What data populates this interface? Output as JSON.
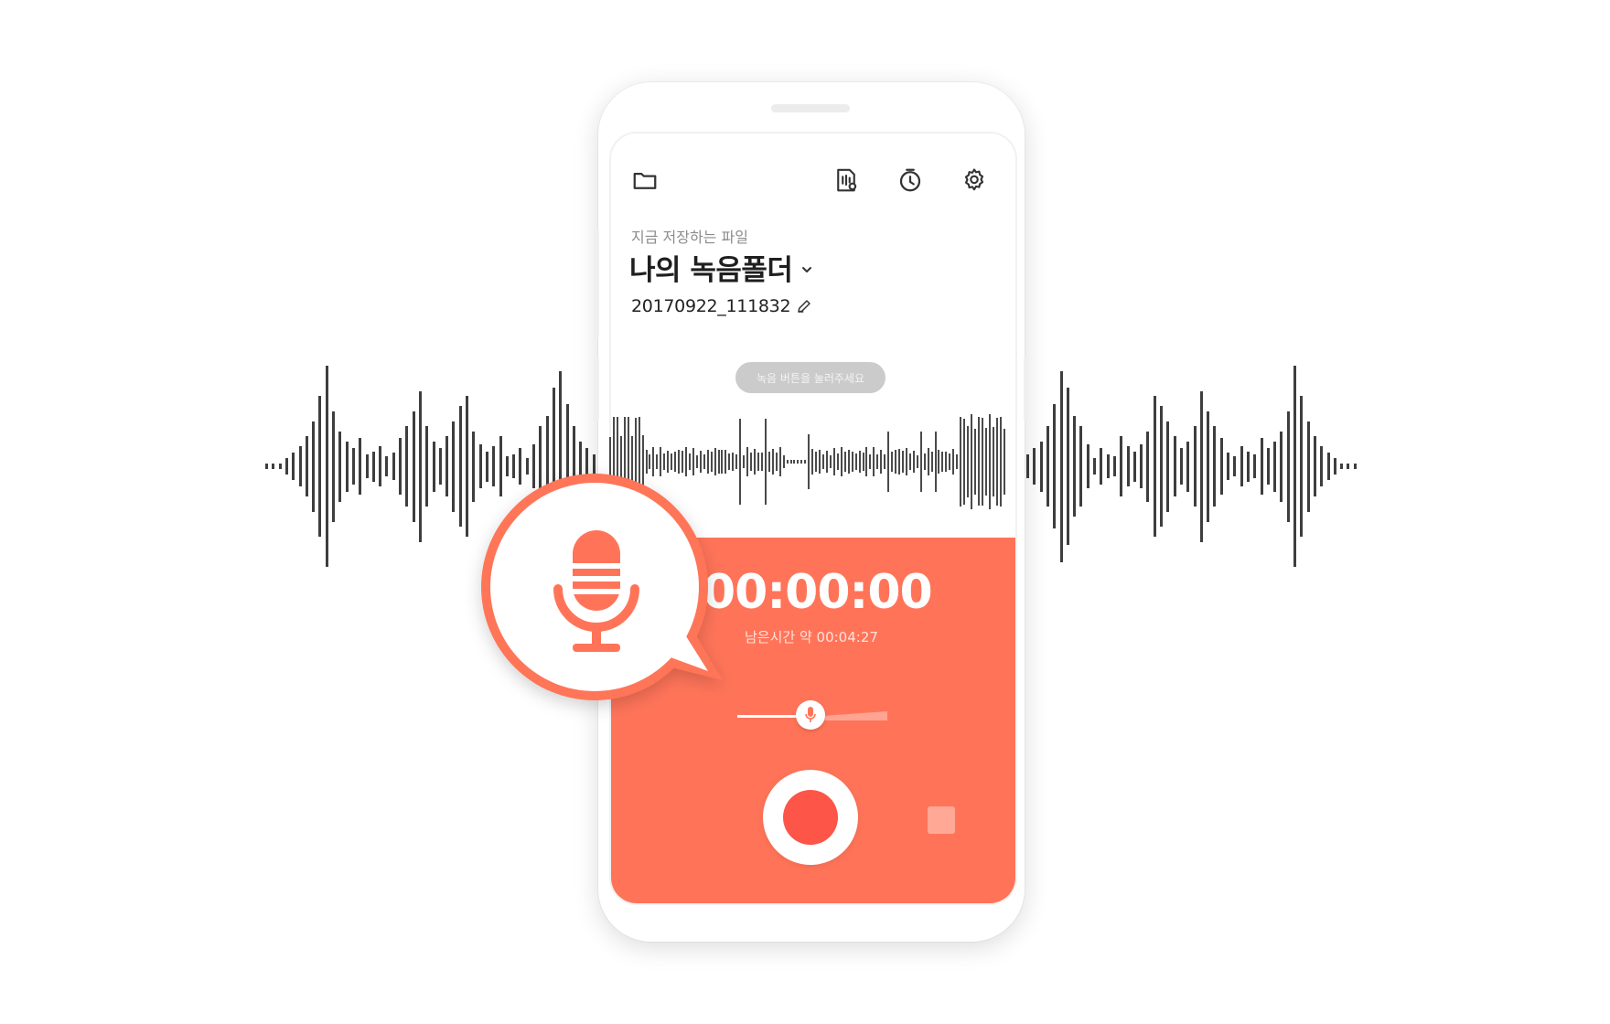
{
  "app": {
    "save_caption": "지금 저장하는 파일",
    "folder_name": "나의 녹음폴더",
    "file_name": "20170922_111832",
    "hint": "녹음 버튼을 눌러주세요",
    "timer": "00:00:00",
    "remaining": "남은시간 약 00:04:27"
  },
  "icons": {
    "top_left": "folder-icon",
    "top_right": [
      "speech-recognition-icon",
      "timer-icon",
      "gear-icon"
    ],
    "file_edit": "pencil-icon",
    "bubble": "microphone-icon"
  },
  "colors": {
    "accent": "#ff7459",
    "record": "#fd5548",
    "stop": "#ffa895",
    "waveform": "#3e3e3e"
  },
  "slider": {
    "level": 0.49
  }
}
